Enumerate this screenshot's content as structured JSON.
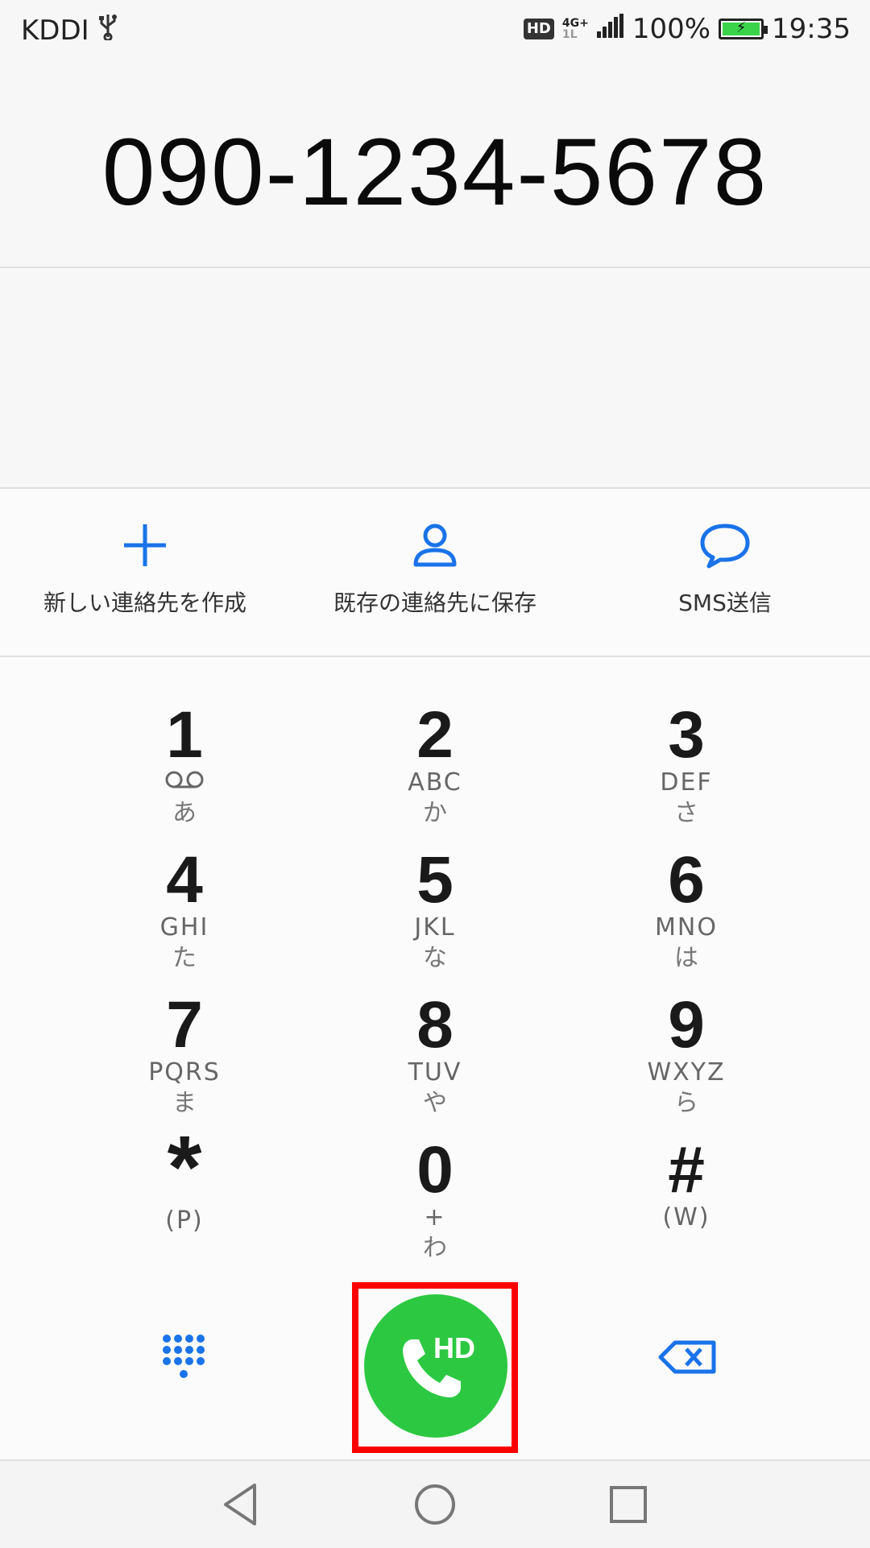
{
  "status_bar": {
    "carrier": "KDDI",
    "hd_badge": "HD",
    "network": "4G+",
    "network_sub": "1L",
    "battery_percent": "100%",
    "battery_level": 1.0,
    "time": "19:35"
  },
  "dialer": {
    "number": "090-1234-5678"
  },
  "actions": [
    {
      "label": "新しい連絡先を作成",
      "icon": "plus-icon"
    },
    {
      "label": "既存の連絡先に保存",
      "icon": "person-icon"
    },
    {
      "label": "SMS送信",
      "icon": "chat-bubble-icon"
    }
  ],
  "keypad": {
    "keys": [
      {
        "digit": "1",
        "sub": "",
        "kana": "あ",
        "icon": "voicemail-icon"
      },
      {
        "digit": "2",
        "sub": "ABC",
        "kana": "か"
      },
      {
        "digit": "3",
        "sub": "DEF",
        "kana": "さ"
      },
      {
        "digit": "4",
        "sub": "GHI",
        "kana": "た"
      },
      {
        "digit": "5",
        "sub": "JKL",
        "kana": "な"
      },
      {
        "digit": "6",
        "sub": "MNO",
        "kana": "は"
      },
      {
        "digit": "7",
        "sub": "PQRS",
        "kana": "ま"
      },
      {
        "digit": "8",
        "sub": "TUV",
        "kana": "や"
      },
      {
        "digit": "9",
        "sub": "WXYZ",
        "kana": "ら"
      },
      {
        "digit": "*",
        "sub": "(P)",
        "kana": ""
      },
      {
        "digit": "0",
        "sub": "+",
        "kana": "わ"
      },
      {
        "digit": "#",
        "sub": "(W)",
        "kana": ""
      }
    ]
  },
  "bottom": {
    "call_label": "HD",
    "accent_color": "#1a73e8",
    "call_color": "#2cc842",
    "highlight_color": "#ff0000"
  }
}
